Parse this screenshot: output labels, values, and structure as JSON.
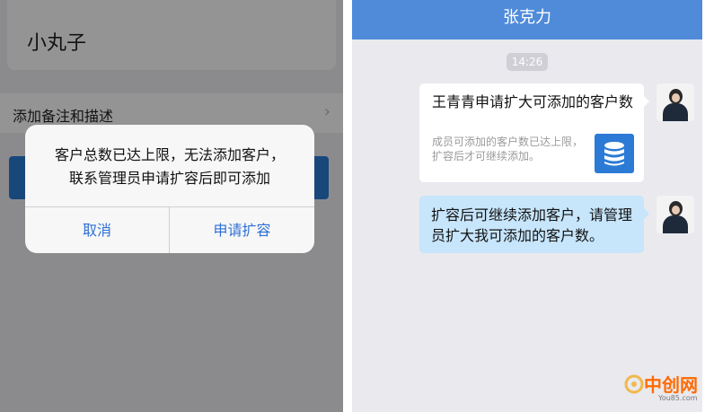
{
  "left": {
    "name_value": "小丸子",
    "remark_label": "添加备注和描述",
    "alert": {
      "message_line1": "客户总数已达上限，无法添加客户，",
      "message_line2": "联系管理员申请扩容后即可添加",
      "cancel_label": "取消",
      "apply_label": "申请扩容"
    }
  },
  "right": {
    "chat_title": "张克力",
    "time": "14:26",
    "card": {
      "title": "王青青申请扩大可添加的客户数",
      "desc": "成员可添加的客户数已达上限，扩容后才可继续添加。"
    },
    "message": "扩容后可继续添加客户，请管理员扩大我可添加的客户数。"
  },
  "watermark": {
    "text": "中创网",
    "sub": "You85.com"
  },
  "colors": {
    "accent_blue": "#2d6fd6",
    "header_blue": "#4f8bd9",
    "bubble_blue": "#c7e5fb",
    "watermark_orange": "#ff6a00"
  },
  "icons": [
    "chevron-right-icon",
    "database-icon",
    "avatar",
    "watermark-logo-icon"
  ]
}
